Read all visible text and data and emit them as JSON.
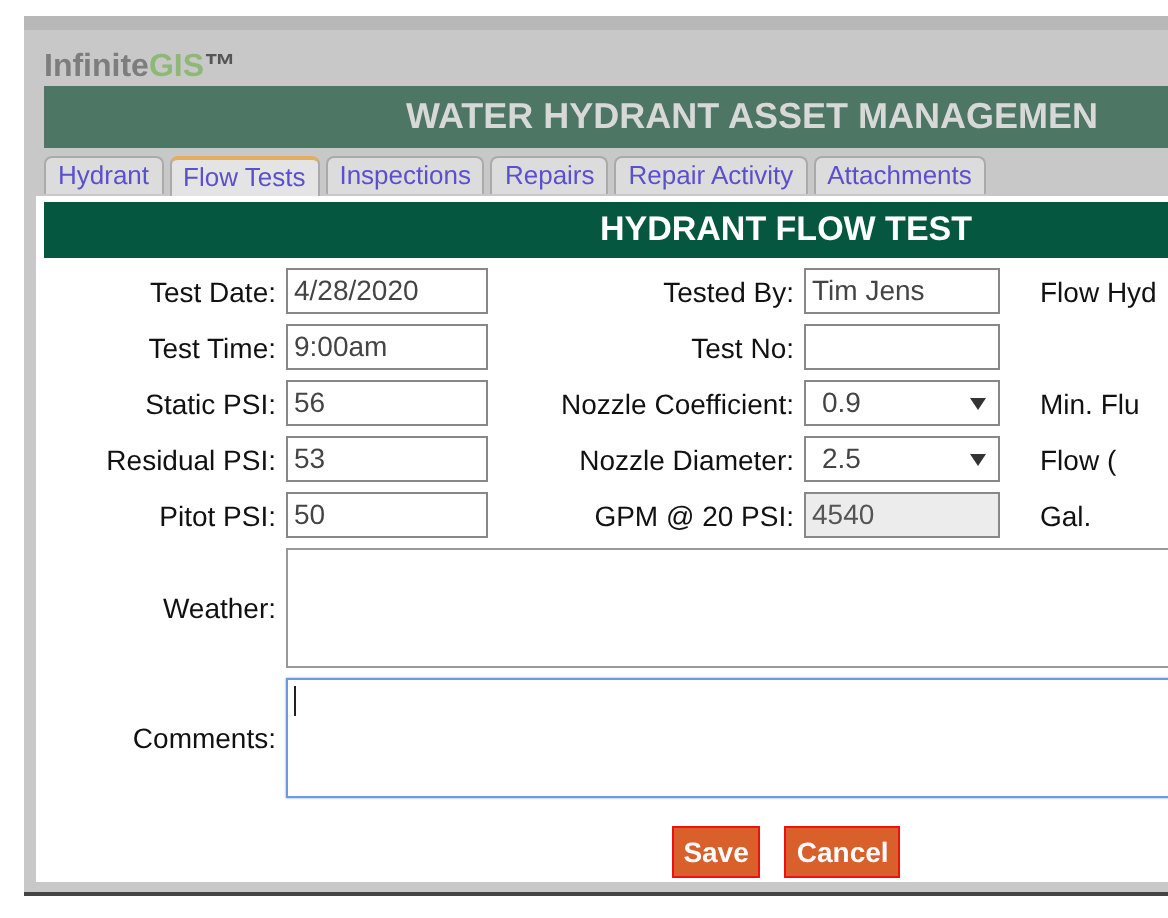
{
  "logo": {
    "text": "Infinite",
    "accent": "GIS",
    "mark": "™"
  },
  "banner": {
    "title": "WATER HYDRANT ASSET MANAGEMEN"
  },
  "tabs": [
    {
      "label": "Hydrant",
      "selected": false
    },
    {
      "label": "Flow Tests",
      "selected": true
    },
    {
      "label": "Inspections",
      "selected": false
    },
    {
      "label": "Repairs",
      "selected": false
    },
    {
      "label": "Repair Activity",
      "selected": false
    },
    {
      "label": "Attachments",
      "selected": false
    }
  ],
  "dialog": {
    "title": "HYDRANT FLOW TEST",
    "rows": [
      [
        {
          "label": "Test Date:",
          "kind": "text",
          "value": "4/28/2020"
        },
        {
          "label": "Tested By:",
          "kind": "text",
          "value": "Tim Jens"
        },
        {
          "label": "Flow Hyd",
          "kind": "label"
        }
      ],
      [
        {
          "label": "Test Time:",
          "kind": "text",
          "value": "9:00am"
        },
        {
          "label": "Test No:",
          "kind": "text"
        }
      ],
      [
        {
          "label": "Static PSI:",
          "kind": "text",
          "value": "56"
        },
        {
          "label": "Nozzle Coefficient:",
          "kind": "select",
          "value": "0.9"
        },
        {
          "label": "Min. Flu",
          "kind": "label"
        }
      ],
      [
        {
          "label": "Residual PSI:",
          "kind": "text",
          "value": "53"
        },
        {
          "label": "Nozzle Diameter:",
          "kind": "select",
          "value": "2.5"
        },
        {
          "label": "Flow (",
          "kind": "label"
        }
      ],
      [
        {
          "label": "Pitot PSI:",
          "kind": "text",
          "value": "50"
        },
        {
          "label": "GPM @ 20 PSI:",
          "kind": "readonly",
          "value": "4540"
        },
        {
          "label": "Gal.",
          "kind": "label"
        }
      ]
    ],
    "areas": [
      {
        "label": "Weather:",
        "focused": false
      },
      {
        "label": "Comments:",
        "focused": true
      }
    ],
    "buttons": [
      "Save",
      "Cancel"
    ]
  }
}
